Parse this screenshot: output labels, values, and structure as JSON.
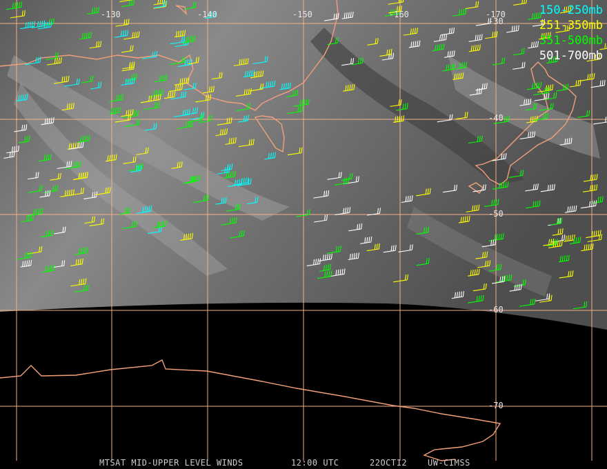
{
  "legend": [
    {
      "label": "150-250mb",
      "color": "#00ffff"
    },
    {
      "label": "251-350mb",
      "color": "#ffff00"
    },
    {
      "label": "351-500mb",
      "color": "#00ff00"
    },
    {
      "label": "501-700mb",
      "color": "#ffffff"
    }
  ],
  "longitude_labels": [
    "-130",
    "-140",
    "-150",
    "-160",
    "-170"
  ],
  "latitude_labels": [
    "-30",
    "-40",
    "-50",
    "-60",
    "-70"
  ],
  "footer": {
    "product": "MTSAT MID-UPPER LEVEL WINDS",
    "time": "12:00 UTC",
    "date": "22OCT12",
    "source": "UW-CIMSS"
  },
  "colors": {
    "grid": "#f4b08a",
    "coastline": "#f4a07a",
    "imagery_gray": "#6b6b6b",
    "night_side": "#000000"
  }
}
